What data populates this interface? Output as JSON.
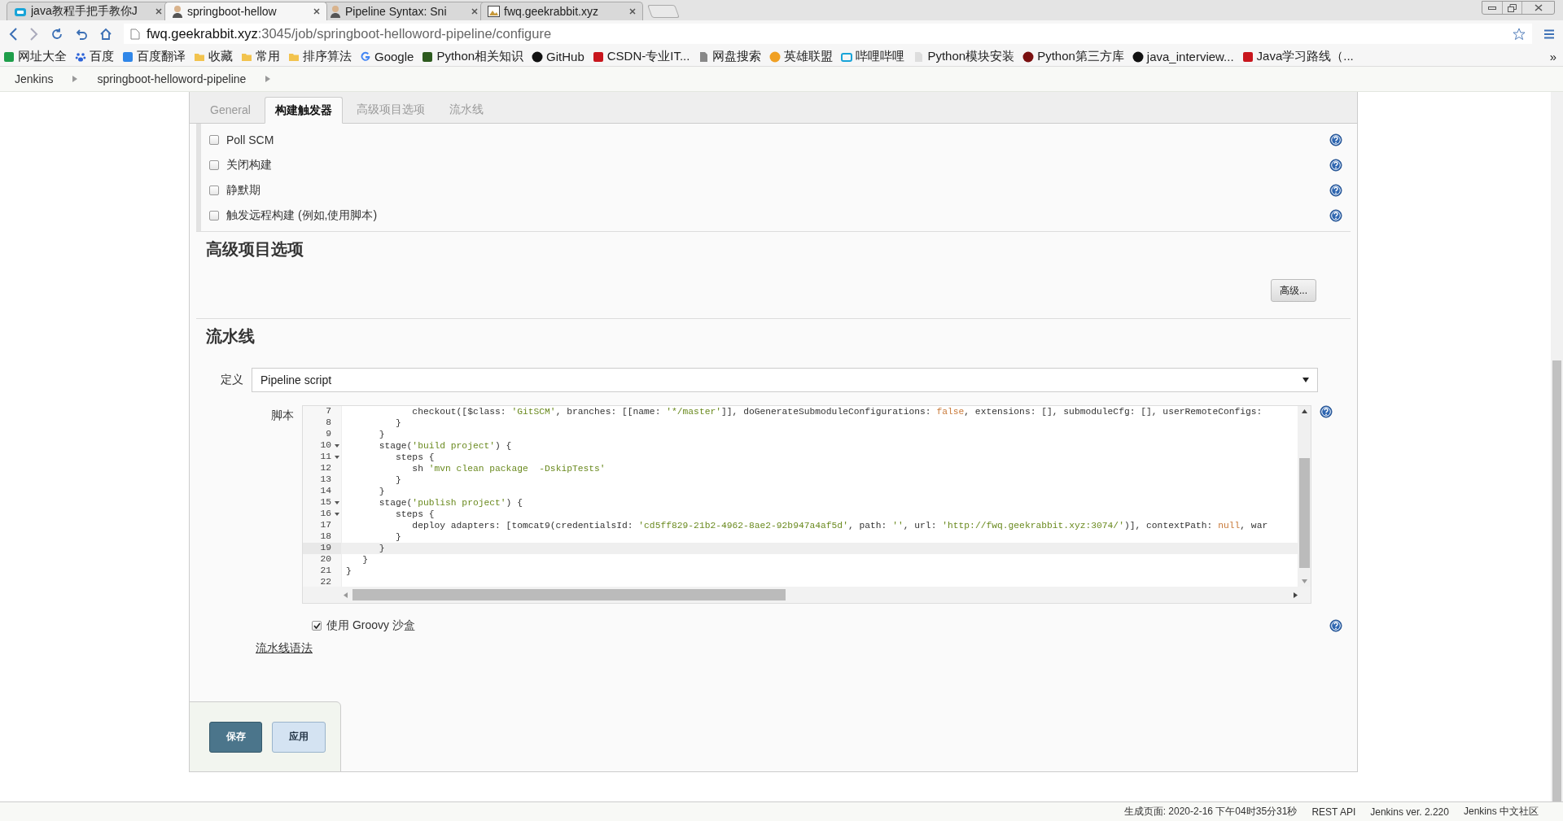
{
  "browser_tabs": [
    {
      "title": "java教程手把手教你J",
      "kind": "tv",
      "selected": false
    },
    {
      "title": "springboot-hellow",
      "kind": "person",
      "selected": true
    },
    {
      "title": "Pipeline Syntax: Sni",
      "kind": "person",
      "selected": false
    },
    {
      "title": "fwq.geekrabbit.xyz",
      "kind": "image",
      "selected": false
    }
  ],
  "address": {
    "host": "fwq.geekrabbit.xyz",
    "path": ":3045/job/springboot-helloword-pipeline/configure"
  },
  "bookmarks": [
    {
      "label": "网址大全",
      "kind": "square",
      "color": "#1e9e4a"
    },
    {
      "label": "百度",
      "kind": "paw",
      "color": "#2b62d8"
    },
    {
      "label": "百度翻译",
      "kind": "square",
      "color": "#2f86e8"
    },
    {
      "label": "收藏",
      "kind": "folder",
      "color": "#f2c34e"
    },
    {
      "label": "常用",
      "kind": "folder",
      "color": "#f2c34e"
    },
    {
      "label": "排序算法",
      "kind": "folder",
      "color": "#f2c34e"
    },
    {
      "label": "Google",
      "kind": "letter",
      "color": "#4285f4"
    },
    {
      "label": "Python相关知识",
      "kind": "square",
      "color": "#2d5a1e"
    },
    {
      "label": "GitHub",
      "kind": "circle",
      "color": "#111111"
    },
    {
      "label": "CSDN-专业IT...",
      "kind": "square",
      "color": "#c8161d"
    },
    {
      "label": "网盘搜索",
      "kind": "page",
      "color": "#888888"
    },
    {
      "label": "英雄联盟",
      "kind": "circle",
      "color": "#f0a023"
    },
    {
      "label": "哔哩哔哩",
      "kind": "tv",
      "color": "#19a4d8"
    },
    {
      "label": "Python模块安装",
      "kind": "page",
      "color": "#dddddd"
    },
    {
      "label": "Python第三方库",
      "kind": "circle",
      "color": "#7a1010"
    },
    {
      "label": "java_interview...",
      "kind": "circle",
      "color": "#111111"
    },
    {
      "label": "Java学习路线（...",
      "kind": "square",
      "color": "#c8161d"
    }
  ],
  "bookmarks_more": "»",
  "breadcrumb": [
    "Jenkins",
    "springboot-helloword-pipeline"
  ],
  "config_tabs": [
    {
      "label": "General",
      "selected": false
    },
    {
      "label": "构建触发器",
      "selected": true
    },
    {
      "label": "高级项目选项",
      "selected": false
    },
    {
      "label": "流水线",
      "selected": false
    }
  ],
  "triggers": [
    {
      "label": "Poll SCM",
      "checked": false
    },
    {
      "label": "关闭构建",
      "checked": false
    },
    {
      "label": "静默期",
      "checked": false
    },
    {
      "label": "触发远程构建 (例如,使用脚本)",
      "checked": false
    }
  ],
  "advanced_section": {
    "title": "高级项目选项",
    "button": "高级..."
  },
  "pipeline_section": {
    "title": "流水线",
    "definition_label": "定义",
    "definition_value": "Pipeline script",
    "script_label": "脚本",
    "code": [
      {
        "number": "7",
        "foldable": false,
        "active": false,
        "segments": [
          {
            "kind": "plain",
            "text": "            checkout([$class: "
          },
          {
            "kind": "string",
            "text": "'GitSCM'"
          },
          {
            "kind": "plain",
            "text": ", branches: [[name: "
          },
          {
            "kind": "string",
            "text": "'*/master'"
          },
          {
            "kind": "plain",
            "text": "]], doGenerateSubmoduleConfigurations: "
          },
          {
            "kind": "literal",
            "text": "false"
          },
          {
            "kind": "plain",
            "text": ", extensions: [], submoduleCfg: [], userRemoteConfigs:"
          }
        ]
      },
      {
        "number": "8",
        "foldable": false,
        "active": false,
        "segments": [
          {
            "kind": "plain",
            "text": "         }"
          }
        ]
      },
      {
        "number": "9",
        "foldable": false,
        "active": false,
        "segments": [
          {
            "kind": "plain",
            "text": "      }"
          }
        ]
      },
      {
        "number": "10",
        "foldable": true,
        "active": false,
        "segments": [
          {
            "kind": "plain",
            "text": "      stage("
          },
          {
            "kind": "string",
            "text": "'build project'"
          },
          {
            "kind": "plain",
            "text": ") {"
          }
        ]
      },
      {
        "number": "11",
        "foldable": true,
        "active": false,
        "segments": [
          {
            "kind": "plain",
            "text": "         steps {"
          }
        ]
      },
      {
        "number": "12",
        "foldable": false,
        "active": false,
        "segments": [
          {
            "kind": "plain",
            "text": "            sh "
          },
          {
            "kind": "string",
            "text": "'mvn clean package  -DskipTests'"
          }
        ]
      },
      {
        "number": "13",
        "foldable": false,
        "active": false,
        "segments": [
          {
            "kind": "plain",
            "text": "         }"
          }
        ]
      },
      {
        "number": "14",
        "foldable": false,
        "active": false,
        "segments": [
          {
            "kind": "plain",
            "text": "      }"
          }
        ]
      },
      {
        "number": "15",
        "foldable": true,
        "active": false,
        "segments": [
          {
            "kind": "plain",
            "text": "      stage("
          },
          {
            "kind": "string",
            "text": "'publish project'"
          },
          {
            "kind": "plain",
            "text": ") {"
          }
        ]
      },
      {
        "number": "16",
        "foldable": true,
        "active": false,
        "segments": [
          {
            "kind": "plain",
            "text": "         steps {"
          }
        ]
      },
      {
        "number": "17",
        "foldable": false,
        "active": false,
        "segments": [
          {
            "kind": "plain",
            "text": "            deploy adapters: [tomcat9(credentialsId: "
          },
          {
            "kind": "string",
            "text": "'cd5ff829-21b2-4962-8ae2-92b947a4af5d'"
          },
          {
            "kind": "plain",
            "text": ", path: "
          },
          {
            "kind": "string",
            "text": "''"
          },
          {
            "kind": "plain",
            "text": ", url: "
          },
          {
            "kind": "string",
            "text": "'http://fwq.geekrabbit.xyz:3074/'"
          },
          {
            "kind": "plain",
            "text": ")], contextPath: "
          },
          {
            "kind": "literal",
            "text": "null"
          },
          {
            "kind": "plain",
            "text": ", war"
          }
        ]
      },
      {
        "number": "18",
        "foldable": false,
        "active": false,
        "segments": [
          {
            "kind": "plain",
            "text": "         }"
          }
        ]
      },
      {
        "number": "19",
        "foldable": false,
        "active": true,
        "segments": [
          {
            "kind": "plain",
            "text": "      }"
          }
        ]
      },
      {
        "number": "20",
        "foldable": false,
        "active": false,
        "segments": [
          {
            "kind": "plain",
            "text": "   }"
          }
        ]
      },
      {
        "number": "21",
        "foldable": false,
        "active": false,
        "segments": [
          {
            "kind": "plain",
            "text": "}"
          }
        ]
      },
      {
        "number": "22",
        "foldable": false,
        "active": false
      }
    ],
    "sandbox": {
      "label": "使用 Groovy 沙盒",
      "checked": true
    },
    "syntax_link": "流水线语法"
  },
  "buttons": [
    {
      "label": "保存",
      "kind": "primary"
    },
    {
      "label": "应用",
      "kind": "secondary"
    }
  ],
  "footer": [
    "生成页面: 2020-2-16 下午04时35分31秒",
    "REST API",
    "Jenkins ver. 2.220",
    "Jenkins 中文社区"
  ]
}
